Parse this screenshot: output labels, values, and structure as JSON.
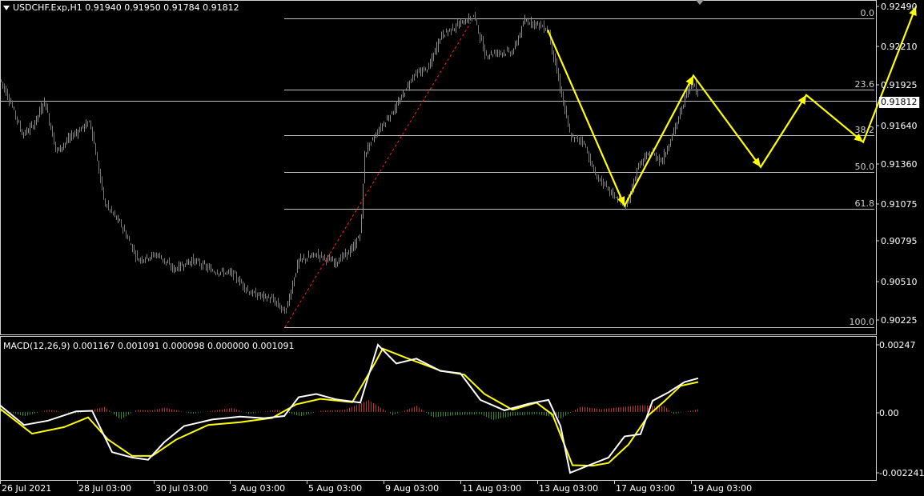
{
  "header": {
    "symbol_line": "USDCHF.Exp,H1  0.91940 0.91950 0.91784 0.91812",
    "menu_icon": "triangle-down-icon"
  },
  "macd_header": "MACD(12,26,9) 0.001167 0.001091 0.000098 0.000000 0.001091",
  "price_axis": {
    "ticks": [
      "0.92490",
      "0.92210",
      "0.91925",
      "0.91640",
      "0.91360",
      "0.91075",
      "0.90795",
      "0.90510",
      "0.90225"
    ],
    "current_price": "0.91812"
  },
  "macd_axis": {
    "ticks": [
      "0.00247",
      "0.00",
      "-0.002241"
    ]
  },
  "time_axis": {
    "ticks": [
      "26 Jul 2021",
      "28 Jul 03:00",
      "30 Jul 03:00",
      "3 Aug 03:00",
      "5 Aug 03:00",
      "9 Aug 03:00",
      "11 Aug 03:00",
      "13 Aug 03:00",
      "17 Aug 03:00",
      "19 Aug 03:00"
    ]
  },
  "fibonacci": {
    "levels": [
      "0.0",
      "23.6",
      "38.2",
      "50.0",
      "61.8",
      "100.0"
    ]
  },
  "colors": {
    "background": "#000000",
    "bull_candle": "#8a8a8a",
    "bear_candle": "#2fa82f",
    "fib_line": "#c0c0c0",
    "projection": "#ffff00",
    "macd_main": "#ffffff",
    "macd_signal": "#ffff00",
    "hist_pos": "#c0302c",
    "hist_neg": "#2e8b2e",
    "trend_dashed": "#ff2020"
  },
  "chart_data": {
    "type": "line",
    "price_path": [
      [
        0.9196,
        0
      ],
      [
        0.9178,
        14
      ],
      [
        0.9156,
        28
      ],
      [
        0.9164,
        42
      ],
      [
        0.9181,
        55
      ],
      [
        0.9144,
        70
      ],
      [
        0.9156,
        90
      ],
      [
        0.9166,
        112
      ],
      [
        0.9107,
        130
      ],
      [
        0.9092,
        150
      ],
      [
        0.9066,
        172
      ],
      [
        0.907,
        196
      ],
      [
        0.9059,
        216
      ],
      [
        0.9066,
        240
      ],
      [
        0.9058,
        265
      ],
      [
        0.9056,
        290
      ],
      [
        0.9042,
        312
      ],
      [
        0.9038,
        338
      ],
      [
        0.9028,
        356
      ],
      [
        0.9065,
        372
      ],
      [
        0.907,
        395
      ],
      [
        0.9064,
        418
      ],
      [
        0.9074,
        440
      ],
      [
        0.9086,
        450
      ],
      [
        0.9143,
        455
      ],
      [
        0.9158,
        470
      ],
      [
        0.9177,
        495
      ],
      [
        0.9199,
        515
      ],
      [
        0.9205,
        535
      ],
      [
        0.9228,
        550
      ],
      [
        0.9236,
        572
      ],
      [
        0.9242,
        592
      ],
      [
        0.9214,
        605
      ],
      [
        0.9216,
        622
      ],
      [
        0.9216,
        640
      ],
      [
        0.9239,
        655
      ],
      [
        0.9236,
        672
      ],
      [
        0.9232,
        684
      ],
      [
        0.9199,
        696
      ],
      [
        0.9154,
        712
      ],
      [
        0.9152,
        728
      ],
      [
        0.9128,
        742
      ],
      [
        0.9116,
        760
      ],
      [
        0.9104,
        782
      ],
      [
        0.9133,
        796
      ],
      [
        0.9144,
        812
      ],
      [
        0.9137,
        826
      ],
      [
        0.9165,
        845
      ],
      [
        0.9188,
        858
      ],
      [
        0.9196,
        866
      ],
      [
        0.91812,
        872
      ]
    ],
    "projection_path": [
      [
        0.9232,
        684
      ],
      [
        0.9105,
        780
      ],
      [
        0.9199,
        866
      ],
      [
        0.9133,
        950
      ],
      [
        0.9185,
        1007
      ],
      [
        0.9151,
        1078
      ],
      [
        0.9249,
        1144
      ]
    ],
    "macd_main_path": [
      [
        0.00024,
        0
      ],
      [
        -0.00048,
        30
      ],
      [
        -0.00032,
        60
      ],
      [
        2e-05,
        95
      ],
      [
        4e-05,
        115
      ],
      [
        -0.00148,
        140
      ],
      [
        -0.00168,
        165
      ],
      [
        -0.00176,
        185
      ],
      [
        -0.00112,
        205
      ],
      [
        -0.00052,
        230
      ],
      [
        -0.00028,
        265
      ],
      [
        -0.00017,
        300
      ],
      [
        -0.00023,
        330
      ],
      [
        -0.00015,
        355
      ],
      [
        0.00054,
        373
      ],
      [
        0.00066,
        395
      ],
      [
        0.00046,
        420
      ],
      [
        0.00034,
        450
      ],
      [
        0.00247,
        472
      ],
      [
        0.00178,
        495
      ],
      [
        0.00196,
        520
      ],
      [
        0.00151,
        550
      ],
      [
        0.00142,
        575
      ],
      [
        0.00044,
        600
      ],
      [
        6e-05,
        630
      ],
      [
        0.0003,
        660
      ],
      [
        0.00044,
        685
      ],
      [
        -0.00052,
        700
      ],
      [
        -0.00224,
        712
      ],
      [
        -0.00197,
        735
      ],
      [
        -0.00168,
        760
      ],
      [
        -0.0009,
        780
      ],
      [
        -0.00082,
        800
      ],
      [
        0.00041,
        815
      ],
      [
        0.00072,
        835
      ],
      [
        0.0011,
        855
      ],
      [
        0.00124,
        872
      ]
    ],
    "macd_signal_path": [
      [
        0.00012,
        0
      ],
      [
        -0.0008,
        40
      ],
      [
        -0.00056,
        80
      ],
      [
        -0.0002,
        110
      ],
      [
        -0.00102,
        135
      ],
      [
        -0.00162,
        165
      ],
      [
        -0.00162,
        190
      ],
      [
        -0.00102,
        220
      ],
      [
        -0.00048,
        260
      ],
      [
        -0.00038,
        300
      ],
      [
        -0.00022,
        340
      ],
      [
        0.00028,
        370
      ],
      [
        0.00048,
        400
      ],
      [
        0.00036,
        440
      ],
      [
        0.00178,
        468
      ],
      [
        0.00233,
        478
      ],
      [
        0.00196,
        510
      ],
      [
        0.00152,
        550
      ],
      [
        0.00137,
        580
      ],
      [
        0.00066,
        605
      ],
      [
        8e-05,
        640
      ],
      [
        0.00034,
        670
      ],
      [
        -0.0001,
        690
      ],
      [
        -0.00196,
        715
      ],
      [
        -0.00198,
        740
      ],
      [
        -0.00188,
        760
      ],
      [
        -0.0012,
        785
      ],
      [
        -0.00012,
        810
      ],
      [
        0.0004,
        830
      ],
      [
        0.00096,
        850
      ],
      [
        0.0011,
        872
      ]
    ],
    "macd_histogram_path": [
      [
        8e-05,
        0
      ],
      [
        -0.00016,
        30
      ],
      [
        8e-05,
        60
      ],
      [
        -6e-05,
        95
      ],
      [
        0.00018,
        130
      ],
      [
        -0.00028,
        150
      ],
      [
        7e-05,
        170
      ],
      [
        6e-05,
        190
      ],
      [
        0.00016,
        205
      ],
      [
        -7e-05,
        240
      ],
      [
        0.00015,
        290
      ],
      [
        -8e-05,
        310
      ],
      [
        8e-05,
        345
      ],
      [
        -0.00016,
        375
      ],
      [
        4e-05,
        400
      ],
      [
        8e-05,
        430
      ],
      [
        0.00043,
        460
      ],
      [
        -0.00012,
        490
      ],
      [
        0.00022,
        520
      ],
      [
        -0.0002,
        540
      ],
      [
        -0.00012,
        570
      ],
      [
        -8e-05,
        600
      ],
      [
        -0.0003,
        615
      ],
      [
        -0.00014,
        640
      ],
      [
        -8e-05,
        670
      ],
      [
        -0.00024,
        700
      ],
      [
        0.0002,
        725
      ],
      [
        0.0001,
        750
      ],
      [
        0.00016,
        770
      ],
      [
        0.00025,
        800
      ],
      [
        0.0002,
        830
      ],
      [
        -8e-05,
        840
      ],
      [
        0.0001,
        872
      ]
    ]
  }
}
